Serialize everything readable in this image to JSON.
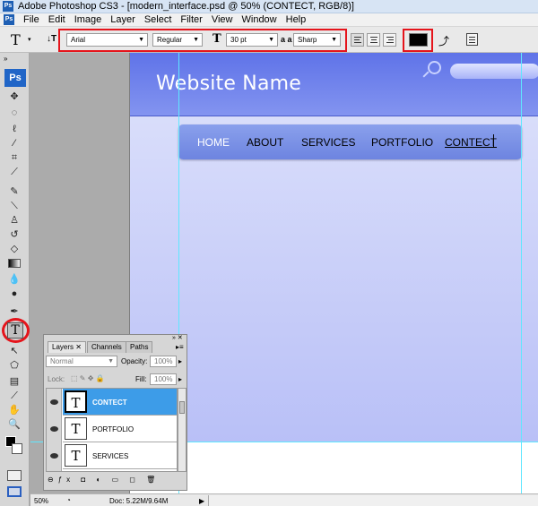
{
  "window": {
    "title": "Adobe Photoshop CS3 - [modern_interface.psd @ 50% (CONTECT, RGB/8)]"
  },
  "app_icon": "Ps",
  "menu": [
    "File",
    "Edit",
    "Image",
    "Layer",
    "Select",
    "Filter",
    "View",
    "Window",
    "Help"
  ],
  "options_bar": {
    "tool_glyph": "T",
    "font_family": "Arial",
    "font_style": "Regular",
    "font_size": "30 pt",
    "aa_label": "a a",
    "antialias": "Sharp",
    "text_color": "#000000"
  },
  "toolbox": {
    "logo": "Ps",
    "active_tool": "T"
  },
  "canvas": {
    "site_name": "Website Name",
    "nav": [
      "HOME",
      "ABOUT",
      "SERVICES",
      "PORTFOLIO",
      "CONTECT"
    ],
    "colors": {
      "header": "#6b7ee9",
      "body": "#c9cef9",
      "highlight": "#ffffff",
      "guide": "#5fe7ff"
    }
  },
  "layers_panel": {
    "tabs": [
      "Layers",
      "Channels",
      "Paths"
    ],
    "blend_mode": "Normal",
    "opacity_label": "Opacity:",
    "opacity": "100%",
    "lock_label": "Lock:",
    "fill_label": "Fill:",
    "fill": "100%",
    "layers": [
      {
        "name": "CONTECT",
        "selected": true
      },
      {
        "name": "PORTFOLIO",
        "selected": false
      },
      {
        "name": "SERVICES",
        "selected": false
      }
    ]
  },
  "status": {
    "zoom": "50%",
    "doc": "Doc: 5.22M/9.64M"
  }
}
